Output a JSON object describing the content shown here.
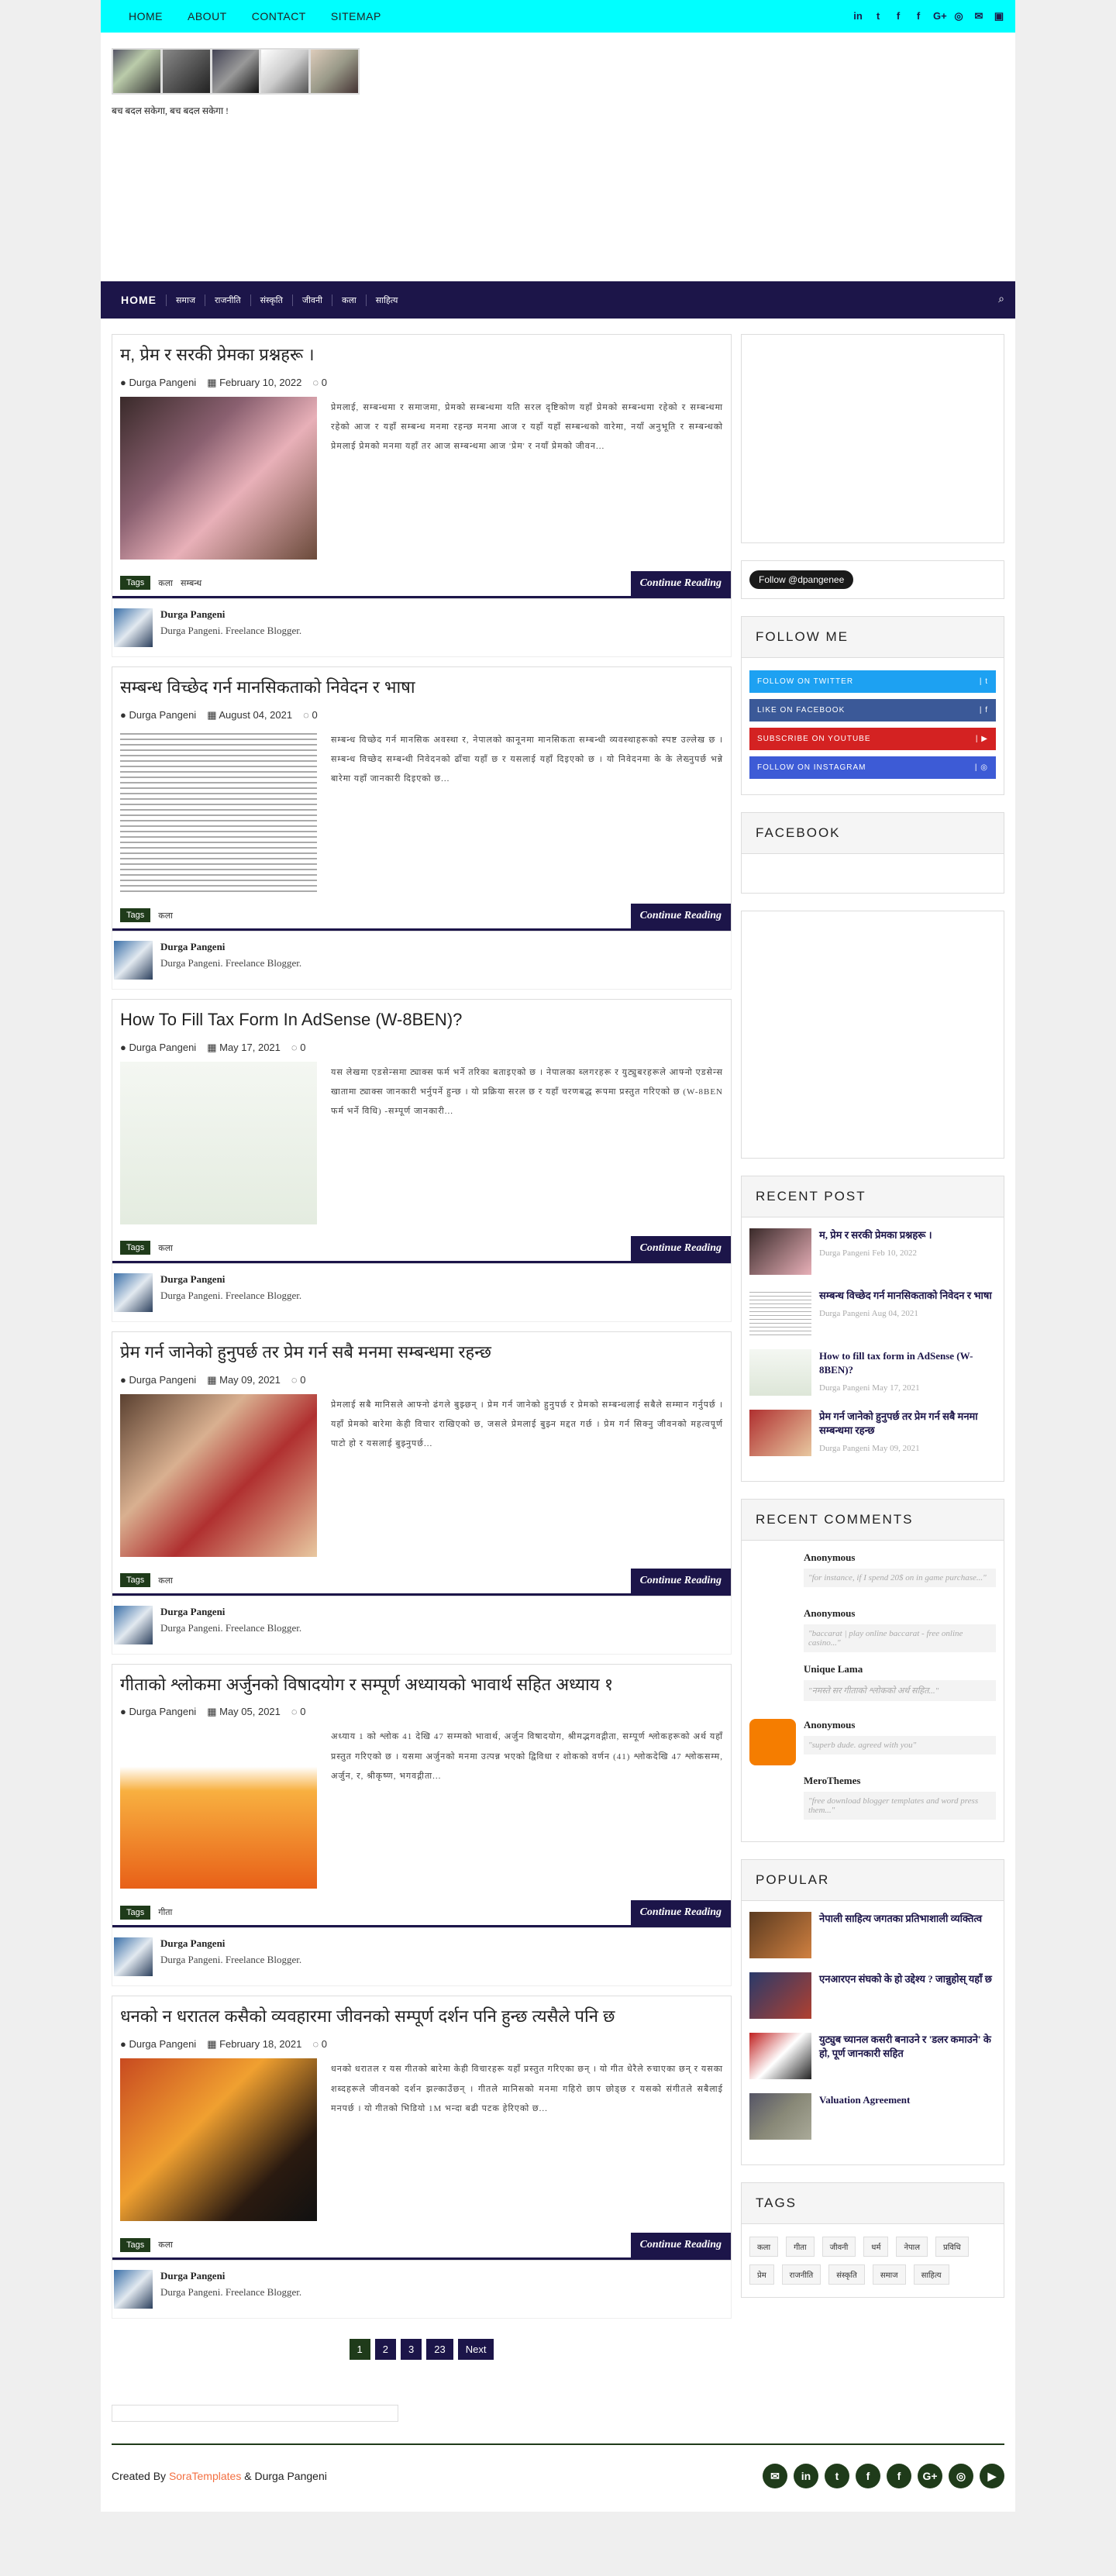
{
  "topnav": [
    "HOME",
    "ABOUT",
    "CONTACT",
    "SITEMAP"
  ],
  "topsoc": [
    "in",
    "t",
    "f",
    "f",
    "G+",
    "◎",
    "✉",
    "▣"
  ],
  "header": {
    "tagline": "बच बदल सकेगा, बच बदल सकेगा !"
  },
  "mainnav": {
    "items": [
      "HOME",
      "समाज",
      "राजनीति",
      "संस्कृति",
      "जीवनी",
      "कला",
      "साहित्य"
    ],
    "search": "⌕"
  },
  "posts": [
    {
      "title": "म, प्रेम र सरकी प्रेमका प्रश्नहरू ।",
      "author": "Durga Pangeni",
      "date": "February 10, 2022",
      "comments": "0",
      "excerpt": "प्रेमलाई, सम्बन्धमा र समाजमा, प्रेमको सम्बन्धमा यति सरल दृष्टिकोण यहाँ प्रेमको सम्बन्धमा रहेको र सम्बन्धमा रहेको आज र यहाँ सम्बन्ध मनमा रहन्छ मनमा आज र यहाँ यहाँ सम्बन्धको वारेमा, नयाँ अनुभूति र सम्बन्धको प्रेमलाई प्रेमको मनमा यहाँ तर आज सम्बन्धमा आज 'प्रेम' र नयाँ प्रेमको जीवन...",
      "tags": [
        "कला",
        "सम्बन्ध"
      ],
      "img": "linear-gradient(135deg,#3a2a2a 0%,#8a6070 35%,#e8b0b8 60%,#6a4a3a 100%)"
    },
    {
      "title": "सम्बन्ध विच्छेद गर्न मानसिकताको निवेदन र भाषा",
      "author": "Durga Pangeni",
      "date": "August 04, 2021",
      "comments": "0",
      "excerpt": "सम्बन्ध विच्छेद गर्न मानसिक अवस्था र, नेपालको कानूनमा मानसिकता सम्बन्धी व्यवस्थाहरूको स्पष्ट उल्लेख छ । सम्बन्ध विच्छेद सम्बन्धी निवेदनको ढाँचा यहाँ छ र यसलाई यहाँ दिइएको छ । यो निवेदनमा के के लेख्नुपर्छ भन्ने बारेमा यहाँ जानकारी दिइएको छ...",
      "tags": [
        "कला"
      ],
      "img": "repeating-linear-gradient(180deg,#fff 0px,#fff 5px,#555 6px,#fff 7px)"
    },
    {
      "title": "How To Fill Tax Form In AdSense (W-8BEN)?",
      "author": "Durga Pangeni",
      "date": "May 17, 2021",
      "comments": "0",
      "excerpt": "यस लेखमा एडसेन्समा ट्याक्स फर्म भर्ने तरिका बताइएको छ । नेपालका ब्लगरहरू र युट्युबरहरूले आफ्नो एडसेन्स खातामा ट्याक्स जानकारी भर्नुपर्ने हुन्छ । यो प्रक्रिया सरल छ र यहाँ चरणबद्ध रूपमा प्रस्तुत गरिएको छ (W-8BEN फर्म भर्ने विधि) -सम्पूर्ण जानकारी...",
      "tags": [
        "कला"
      ],
      "img": "linear-gradient(180deg,#f4f7f2 0%,#e4ece0 100%)"
    },
    {
      "title": "प्रेम गर्न जानेको हुनुपर्छ तर प्रेम गर्न सबै मनमा सम्बन्धमा रहन्छ",
      "author": "Durga Pangeni",
      "date": "May 09, 2021",
      "comments": "0",
      "excerpt": "प्रेमलाई सबै मानिसले आफ्नो ढंगले बुझ्छन् । प्रेम गर्न जानेको हुनुपर्छ र प्रेमको सम्बन्धलाई सबैले सम्मान गर्नुपर्छ । यहाँ प्रेमको बारेमा केही विचार राखिएको छ, जसले प्रेमलाई बुझ्न मद्दत गर्छ । प्रेम गर्न सिक्नु जीवनको महत्वपूर्ण पाटो हो र यसलाई बुझ्नुपर्छ...",
      "tags": [
        "कला"
      ],
      "img": "linear-gradient(135deg,#5a4030 0%,#d9b090 35%,#b03030 60%,#e8c8a0 100%)"
    },
    {
      "title": "गीताको श्लोकमा अर्जुनको विषादयोग र सम्पूर्ण अध्यायको भावार्थ सहित अध्याय १",
      "author": "Durga Pangeni",
      "date": "May 05, 2021",
      "comments": "0",
      "excerpt": "अध्याय 1 को श्लोक 41 देखि 47 सम्मको भावार्थ, अर्जुन विषादयोग, श्रीमद्भगवद्गीता, सम्पूर्ण श्लोकहरूको अर्थ यहाँ प्रस्तुत गरिएको छ । यसमा अर्जुनको मनमा उत्पन्न भएको द्विविधा र शोकको वर्णन (41) श्लोकदेखि 47 श्लोकसम्म, अर्जुन, र, श्रीकृष्ण, भगवद्गीता...",
      "tags": [
        "गीता"
      ],
      "img": "linear-gradient(180deg,#fff 0%,#fff 25%,#f8b040 40%,#e86018 100%)"
    },
    {
      "title": "धनको न धरातल कसैको व्यवहारमा जीवनको सम्पूर्ण दर्शन पनि हुन्छ त्यसैले पनि छ",
      "author": "Durga Pangeni",
      "date": "February 18, 2021",
      "comments": "0",
      "excerpt": "धनको धरातल र यस गीतको बारेमा केही विचारहरू यहाँ प्रस्तुत गरिएका छन् । यो गीत धेरैले रुचाएका छन् र यसका शब्दहरूले जीवनको दर्शन झल्काउँछन् । गीतले मानिसको मनमा गहिरो छाप छोड्छ र यसको संगीतले सबैलाई मनपर्छ । यो गीतको भिडियो 1M भन्दा बढी पटक हेरिएको छ...",
      "tags": [
        "कला"
      ],
      "img": "linear-gradient(135deg,#c84a20 0%,#f0a030 40%,#2a1a10 75%,#111 100%)"
    }
  ],
  "read_more": "Continue Reading",
  "tags_label": "Tags",
  "author_desc": "Durga Pangeni. Freelance Blogger.",
  "pager": [
    "1",
    "2",
    "3",
    "23",
    "Next"
  ],
  "sidebar": {
    "follow_btn": "Follow @dpangenee",
    "follow_me_title": "FOLLOW ME",
    "follow_links": [
      {
        "label": "FOLLOW ON TWITTER",
        "icon": "t",
        "color": "#1da1f2"
      },
      {
        "label": "LIKE ON FACEBOOK",
        "icon": "f",
        "color": "#3b5998"
      },
      {
        "label": "SUBSCRIBE ON YOUTUBE",
        "icon": "▶",
        "color": "#d42222"
      },
      {
        "label": "FOLLOW ON INSTAGRAM",
        "icon": "◎",
        "color": "#3d5bd6"
      }
    ],
    "facebook_title": "FACEBOOK",
    "recent_post_title": "RECENT POST",
    "recent_posts": [
      {
        "title": "म, प्रेम र सरकी प्रेमका प्रश्नहरू ।",
        "author": "Durga Pangeni",
        "date": "Feb 10, 2022",
        "img": "linear-gradient(135deg,#3a2a2a,#e8b0b8)"
      },
      {
        "title": "सम्बन्ध विच्छेद गर्न मानसिकताको निवेदन र भाषा",
        "author": "Durga Pangeni",
        "date": "Aug 04, 2021",
        "img": "repeating-linear-gradient(180deg,#fff 0px,#fff 4px,#666 5px)"
      },
      {
        "title": "How to fill tax form in AdSense (W-8BEN)?",
        "author": "Durga Pangeni",
        "date": "May 17, 2021",
        "img": "linear-gradient(180deg,#f4f7f2,#dde6d8)"
      },
      {
        "title": "प्रेम गर्न जानेको हुनुपर्छ तर प्रेम गर्न सबै मनमा सम्बन्धमा रहन्छ",
        "author": "Durga Pangeni",
        "date": "May 09, 2021",
        "img": "linear-gradient(135deg,#b03030,#e8c8a0)"
      }
    ],
    "recent_comments_title": "RECENT COMMENTS",
    "comments": [
      {
        "name": "Anonymous",
        "text": "\"for instance, if I spend 20$ on in game purchase...\"",
        "color": "#fff"
      },
      {
        "name": "Anonymous",
        "text": "\"baccarat | play online baccarat - free online casino...\"",
        "color": "#fff"
      },
      {
        "name": "Unique Lama",
        "text": "\"नमस्ते सर गीताको श्लोकको अर्थ सहित...\"",
        "color": "#fff"
      },
      {
        "name": "Anonymous",
        "text": "\"superb dude. agreed with you\"",
        "color": "#f57d00"
      },
      {
        "name": "MeroThemes",
        "text": "\"free download blogger templates and word press them...\"",
        "color": "#fff"
      }
    ],
    "popular_title": "POPULAR",
    "popular": [
      {
        "title": "नेपाली साहित्य जगतका प्रतिभाशाली व्यक्तित्व",
        "img": "linear-gradient(135deg,#5a3a20,#d08040)"
      },
      {
        "title": "एनआरएन संघको के हो उद्देश्य ? जान्नुहोस् यहाँ छ",
        "img": "linear-gradient(135deg,#2a3a6a,#b04030)"
      },
      {
        "title": "युट्युब च्यानल कसरी बनाउने र 'डलर कमाउने' के हो, पूर्ण जानकारी सहित",
        "img": "linear-gradient(135deg,#c02020,#fff,#222)"
      },
      {
        "title": "Valuation Agreement",
        "img": "linear-gradient(135deg,#556,#887,#aa9)"
      }
    ],
    "tags_title": "TAGS",
    "tags": [
      "कला",
      "गीता",
      "जीवनी",
      "धर्म",
      "नेपाल",
      "प्रविधि",
      "प्रेम",
      "राजनीति",
      "संस्कृति",
      "समाज",
      "साहित्य"
    ]
  },
  "footer": {
    "created_by": "Created By",
    "brand": "SoraTemplates",
    "sep": " & ",
    "owner": "Durga Pangeni",
    "social": [
      "✉",
      "in",
      "t",
      "f",
      "f",
      "G+",
      "◎",
      "▶"
    ]
  }
}
